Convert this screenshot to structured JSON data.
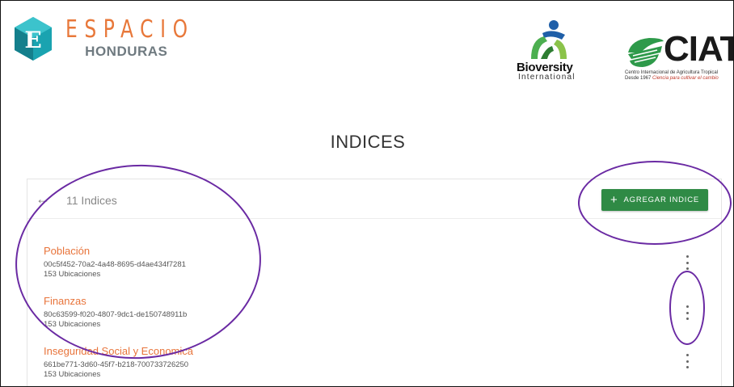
{
  "branding": {
    "espacio_title": "ESPACIO",
    "espacio_subtitle": "HONDURAS",
    "bioversity_name": "Bioversity",
    "bioversity_sub": "International",
    "ciat_name": "CIAT",
    "ciat_line1": "Centro Internacional de Agricultura Tropical",
    "ciat_line2_prefix": "Desde 1967",
    "ciat_line2_tagline": "Ciencia para cultivar el cambio",
    "colors": {
      "espacio_orange": "#e8783a",
      "ciat_green": "#2e9a4a",
      "bioversity_blue": "#1f5fa8"
    }
  },
  "page": {
    "title": "INDICES"
  },
  "card": {
    "back_icon": "arrow-left-icon",
    "count_label": "11 Indices",
    "add_button_label": "AGREGAR INDICE",
    "add_button_icon": "plus-icon",
    "accent_color": "#2f8a45",
    "items": [
      {
        "name": "Población",
        "id": "00c5f452-70a2-4a48-8695-d4ae434f7281",
        "locations": "153 Ubicaciones"
      },
      {
        "name": "Finanzas",
        "id": "80c63599-f020-4807-9dc1-de150748911b",
        "locations": "153 Ubicaciones"
      },
      {
        "name": "Inseguridad Social y Economica",
        "id": "661be771-3d60-45f7-b218-700733726250",
        "locations": "153 Ubicaciones"
      }
    ]
  }
}
